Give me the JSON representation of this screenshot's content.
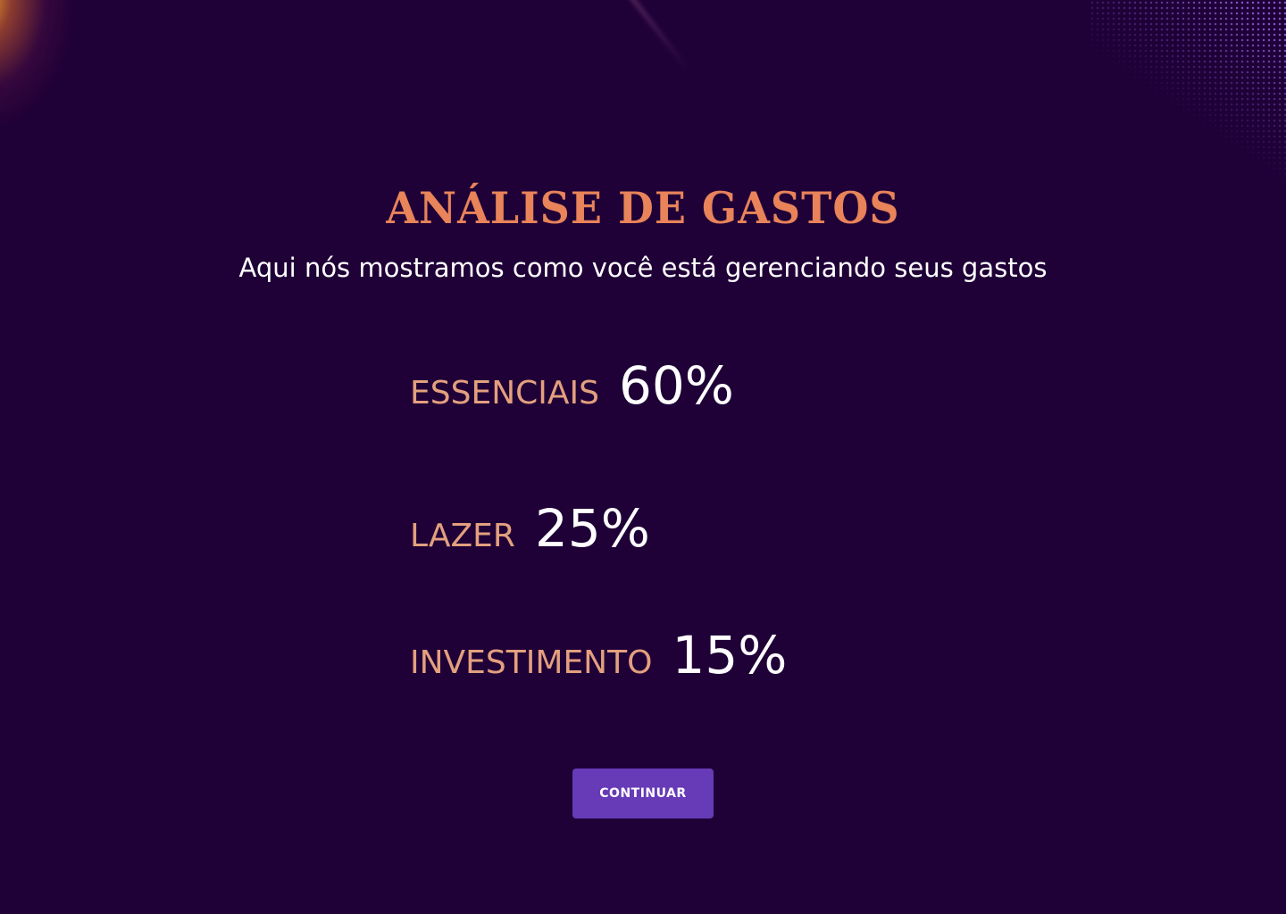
{
  "header": {
    "title": "ANÁLISE DE GASTOS",
    "subtitle": "Aqui nós mostramos como você está gerenciando seus gastos"
  },
  "spending": {
    "items": [
      {
        "label": "ESSENCIAIS",
        "value": "60%"
      },
      {
        "label": "LAZER",
        "value": "25%"
      },
      {
        "label": "INVESTIMENTO",
        "value": "15%"
      }
    ]
  },
  "actions": {
    "continue_label": "CONTINUAR"
  },
  "colors": {
    "background": "#1f0037",
    "title": "#e8835a",
    "label": "#e3a07e",
    "value": "#ffffff",
    "button": "#673ab7"
  }
}
